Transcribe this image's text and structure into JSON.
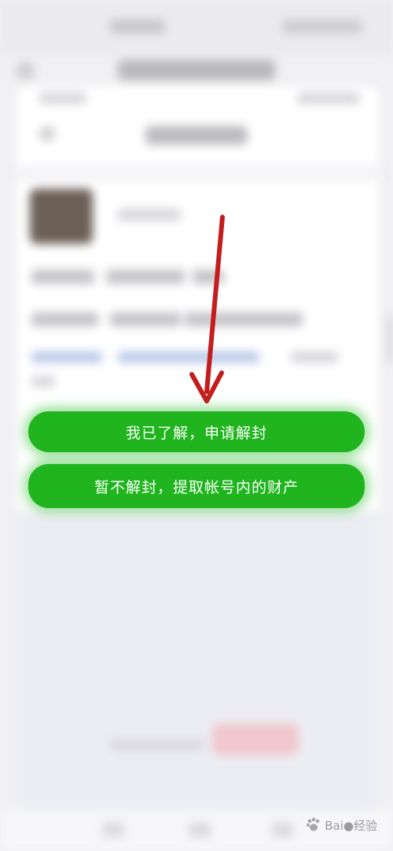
{
  "buttons": {
    "apply_unban": "我已了解，申请解封",
    "withdraw_assets": "暂不解封，提取帐号内的财产"
  },
  "watermark": {
    "text": "Bai●经验"
  },
  "annotation": {
    "arrow_color": "#c21e1e"
  },
  "colors": {
    "button_green": "#20b51e"
  }
}
